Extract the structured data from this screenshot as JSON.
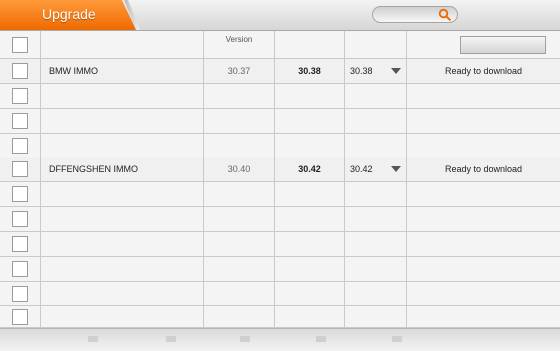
{
  "header": {
    "tab_label": "Upgrade"
  },
  "table": {
    "header_version": "Version",
    "rows": [
      {
        "name": "BMW IMMO",
        "current": "30.37",
        "latest": "30.38",
        "selected": "30.38",
        "status": "Ready to download"
      },
      {
        "name": "DFFENGSHEN IMMO",
        "current": "30.40",
        "latest": "30.42",
        "selected": "30.42",
        "status": "Ready to download"
      }
    ]
  },
  "colors": {
    "accent": "#ee6a00",
    "background": "#e9e9e9"
  },
  "icons": [
    "search-icon",
    "dropdown-arrow-icon"
  ]
}
